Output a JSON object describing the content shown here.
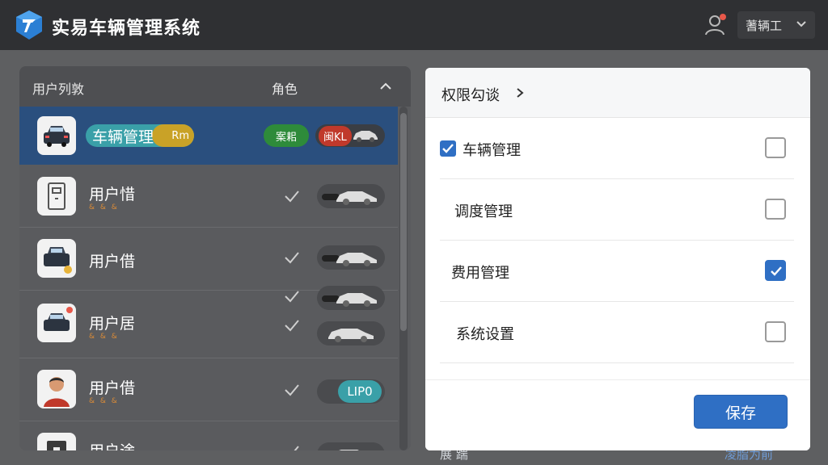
{
  "app": {
    "title": "实易车辆管理系统"
  },
  "header": {
    "user_name": "蓍辆工"
  },
  "left_panel": {
    "col_user": "用户列敦",
    "col_role": "角色",
    "rows": [
      {
        "name": "车辆管理",
        "tag": "Rm",
        "badge1": "案耜",
        "badge2": "闽KL",
        "selected": true
      },
      {
        "name": "用户惜",
        "sub": "& & &"
      },
      {
        "name": "用户借",
        "sub": ""
      },
      {
        "name": "用户居",
        "sub": "& & &"
      },
      {
        "name": "用户借",
        "sub": "& & &",
        "badge": "LIP0"
      },
      {
        "name": "用户途",
        "sub": ""
      }
    ]
  },
  "right_panel": {
    "title": "权限勾谈",
    "permissions": [
      {
        "label": "车辆管理",
        "checked": false,
        "lead_checked": true
      },
      {
        "label": "调度管理",
        "checked": false
      },
      {
        "label": "费用管理",
        "checked": true
      },
      {
        "label": "系统设置",
        "checked": false
      }
    ],
    "save_label": "保存",
    "bottom_left": "展 踹",
    "bottom_right": "凌脂为前"
  },
  "colors": {
    "topbar": "#2f3033",
    "selected_row": "#2a4f7e",
    "accent_blue": "#2f6fc4",
    "badge_green": "#2e8b3a",
    "badge_red": "#c0392b"
  }
}
